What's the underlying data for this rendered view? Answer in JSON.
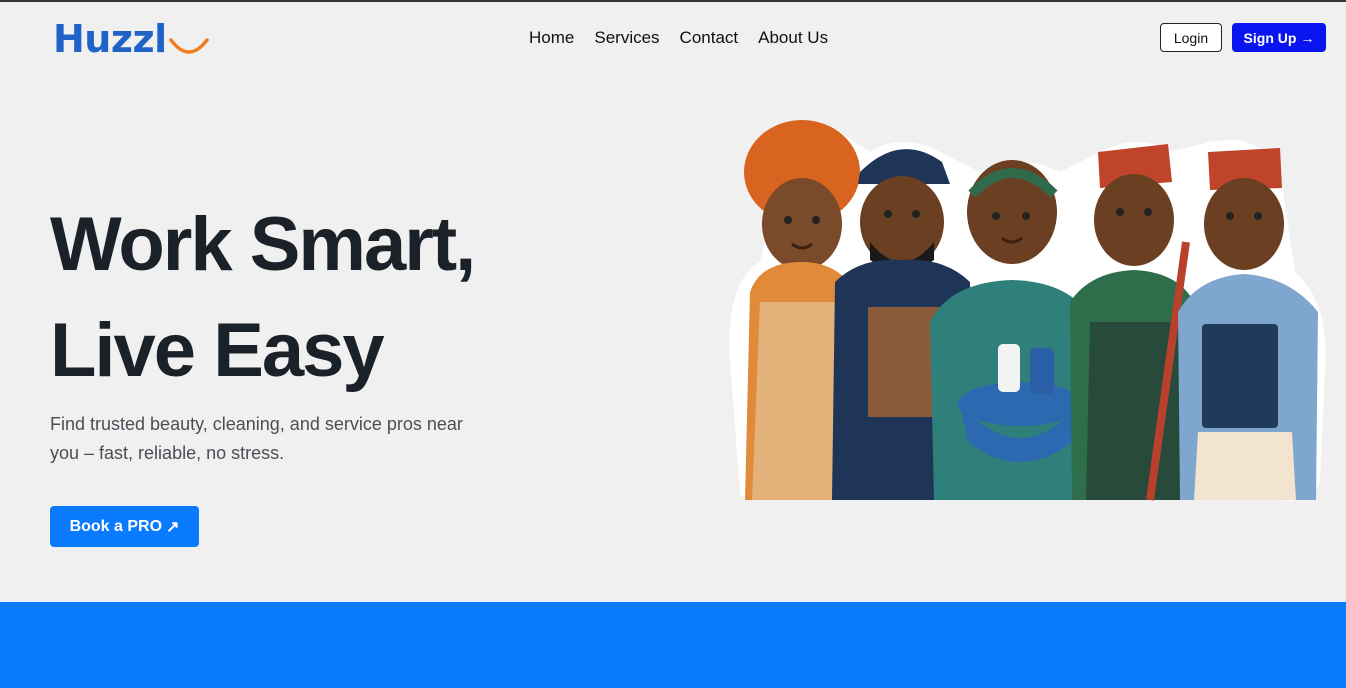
{
  "brand": {
    "name": "Huzzl",
    "smile_icon": "smile-icon"
  },
  "nav": {
    "items": [
      {
        "label": "Home"
      },
      {
        "label": "Services"
      },
      {
        "label": "Contact"
      },
      {
        "label": "About Us"
      }
    ]
  },
  "auth": {
    "login_label": "Login",
    "signup_label": "Sign Up",
    "signup_icon": "→"
  },
  "hero": {
    "title_line1": "Work Smart,",
    "title_line2": "Live Easy",
    "subtitle": "Find trusted beauty, cleaning, and service pros near you – fast, reliable, no stress.",
    "cta_label": "Book a PRO",
    "cta_icon": "↗"
  },
  "colors": {
    "brand_blue": "#1f63c9",
    "smile_orange": "#f07c1e",
    "signup_blue": "#0a14f0",
    "cta_blue": "#0a7bff",
    "background": "#f0f0f0"
  }
}
